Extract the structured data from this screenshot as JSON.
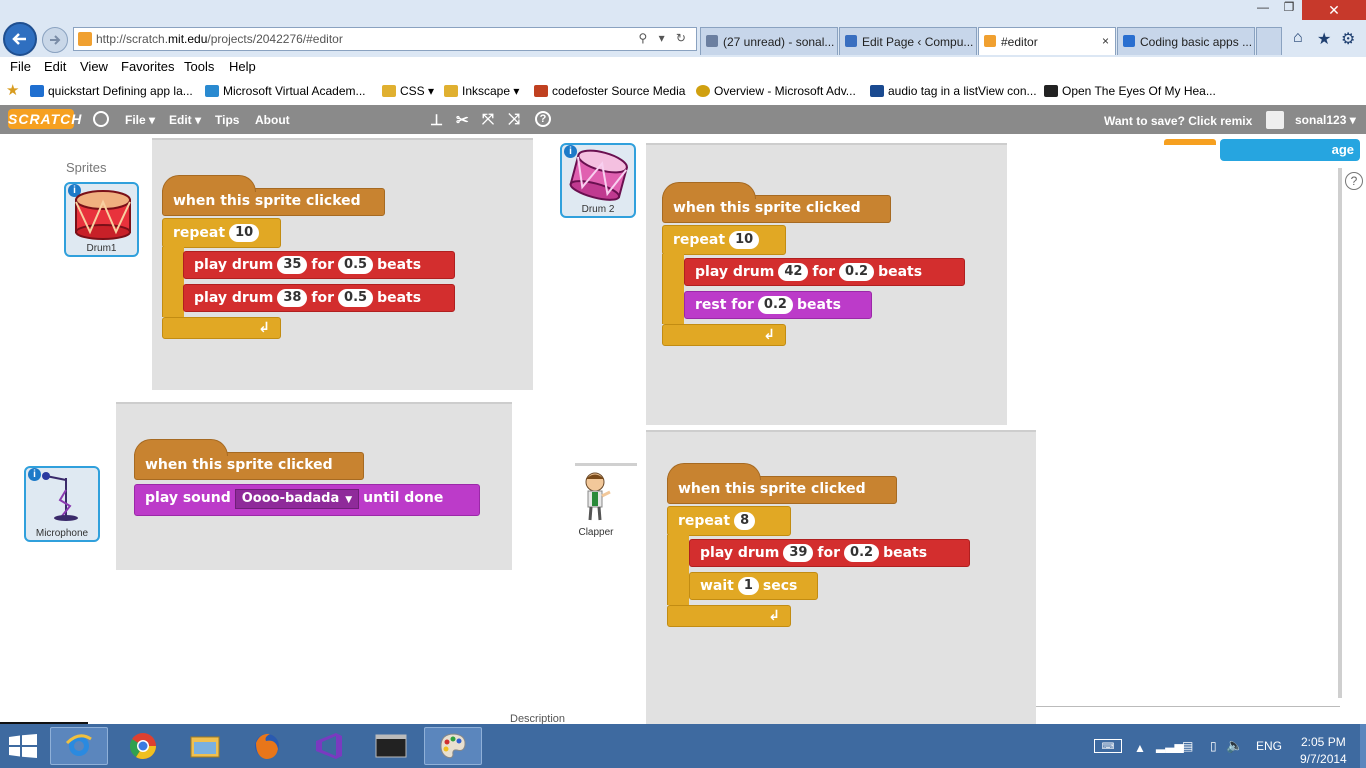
{
  "browser": {
    "url_prefix": "http://scratch.",
    "url_domain": "mit.edu",
    "url_path": "/projects/2042276/#editor",
    "address_icons": "⚲ ▾ ↻",
    "tabs": [
      {
        "label": "(27 unread) - sonal...",
        "icon_color": "#6b7fa0",
        "active": false
      },
      {
        "label": "Edit Page ‹ Compu...",
        "icon_color": "#3a6fc0",
        "active": false
      },
      {
        "label": "#editor",
        "icon_color": "#f0a030",
        "active": true
      },
      {
        "label": "Coding basic apps ...",
        "icon_color": "#2a6fd0",
        "active": false
      }
    ],
    "tab_close": "×"
  },
  "menu": [
    "File",
    "Edit",
    "View",
    "Favorites",
    "Tools",
    "Help"
  ],
  "favorites": [
    {
      "label": "quickstart Defining app la...",
      "color": "#1f6fd0"
    },
    {
      "label": "Microsoft Virtual Academ...",
      "color": "#2a8ad0"
    },
    {
      "label": "CSS ▾",
      "color": "#e0b030"
    },
    {
      "label": "Inkscape ▾",
      "color": "#e0b030"
    },
    {
      "label": "codefoster Source Media",
      "color": "#c04020"
    },
    {
      "label": "Overview - Microsoft Adv...",
      "color": "#d0a010"
    },
    {
      "label": "audio tag in a listView con...",
      "color": "#1a4a90"
    },
    {
      "label": "Open The Eyes Of My Hea...",
      "color": "#222222"
    }
  ],
  "scratch": {
    "logo": "SCRATCH",
    "menus": [
      "File ▾",
      "Edit ▾",
      "Tips",
      "About"
    ],
    "save_msg": "Want to save? Click remix",
    "user": "sonal123 ▾",
    "blue_button": "age",
    "help": "?"
  },
  "sprites_header": "Sprites",
  "sprites": [
    {
      "name": "Drum1"
    },
    {
      "name": "Drum 2"
    },
    {
      "name": "Microphone"
    },
    {
      "name": "Clapper"
    }
  ],
  "scripts": {
    "drum1": {
      "hat": "when this sprite clicked",
      "repeat_label": "repeat",
      "repeat_count": "10",
      "b1": {
        "prefix": "play drum",
        "drum": "35",
        "for": "for",
        "beats": "0.5",
        "suffix": "beats"
      },
      "b2": {
        "prefix": "play drum",
        "drum": "38",
        "for": "for",
        "beats": "0.5",
        "suffix": "beats"
      },
      "arrow": "↲"
    },
    "drum2": {
      "hat": "when this sprite clicked",
      "repeat_label": "repeat",
      "repeat_count": "10",
      "b1": {
        "prefix": "play drum",
        "drum": "42",
        "for": "for",
        "beats": "0.2",
        "suffix": "beats"
      },
      "b2": {
        "prefix": "rest for",
        "beats": "0.2",
        "suffix": "beats"
      },
      "arrow": "↲"
    },
    "microphone": {
      "hat": "when this sprite clicked",
      "b1": {
        "prefix": "play sound",
        "sound": "Oooo-badada",
        "suffix": "until done"
      }
    },
    "clapper": {
      "hat": "when this sprite clicked",
      "repeat_label": "repeat",
      "repeat_count": "8",
      "b1": {
        "prefix": "play drum",
        "drum": "39",
        "for": "for",
        "beats": "0.2",
        "suffix": "beats"
      },
      "b2": {
        "prefix": "wait",
        "secs": "1",
        "suffix": "secs"
      },
      "arrow": "↲"
    }
  },
  "description_label": "Description",
  "taskbar": {
    "language": "ENG",
    "time": "2:05 PM",
    "date": "9/7/2014"
  }
}
